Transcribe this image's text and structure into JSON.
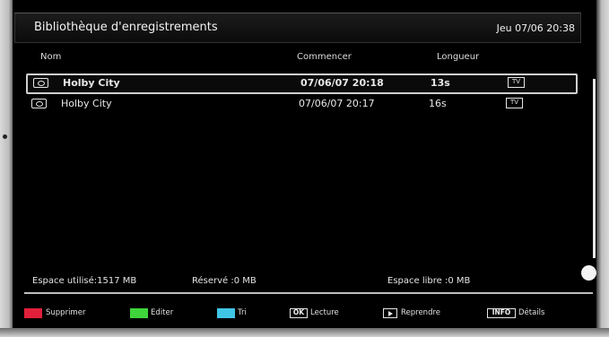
{
  "header": {
    "title": "Bibliothèque d'enregistrements",
    "clock": "Jeu 07/06 20:38"
  },
  "columns": {
    "name": "Nom",
    "start": "Commencer",
    "length": "Longueur"
  },
  "recordings": [
    {
      "name": "Holby City",
      "start": "07/06/07  20:18",
      "length": "13s",
      "type": "TV",
      "selected": true
    },
    {
      "name": "Holby City",
      "start": "07/06/07  20:17",
      "length": "16s",
      "type": "TV",
      "selected": false
    }
  ],
  "storage": {
    "used": "Espace utilisé:1517 MB",
    "reserved": "Réservé :0 MB",
    "free": "Espace libre :0 MB"
  },
  "legend": {
    "delete": {
      "label": "Supprimer",
      "color": "#e0203a"
    },
    "edit": {
      "label": "Editer",
      "color": "#3fd43a"
    },
    "sort": {
      "label": "Tri",
      "color": "#3fc6e6"
    },
    "play": {
      "key": "OK",
      "label": "Lecture"
    },
    "resume": {
      "label": "Reprendre"
    },
    "details": {
      "key": "INFO",
      "label": "Détails"
    }
  },
  "icons": {
    "record": "recording-icon",
    "tv": "tv-icon",
    "play_key": "play-icon"
  }
}
